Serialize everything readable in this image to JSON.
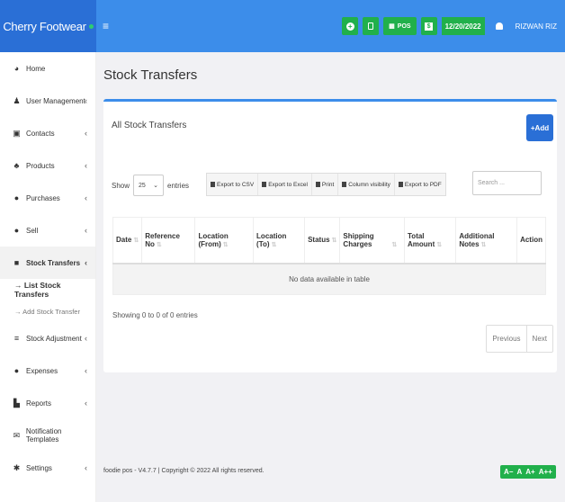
{
  "brand": {
    "name": "Cherry Footwear"
  },
  "topbar": {
    "menu_icon": "≡",
    "pos_label": "POS",
    "date": "12/20/2022",
    "user": "RIZWAN RIZ"
  },
  "sidebar": {
    "items": [
      {
        "label": "Home",
        "icon": "dashboard-icon",
        "chevron": ""
      },
      {
        "label": "User Management",
        "icon": "users-icon",
        "chevron": "‹"
      },
      {
        "label": "Contacts",
        "icon": "address-book-icon",
        "chevron": "‹"
      },
      {
        "label": "Products",
        "icon": "cubes-icon",
        "chevron": "‹"
      },
      {
        "label": "Purchases",
        "icon": "arrow-circle-down-icon",
        "chevron": "‹"
      },
      {
        "label": "Sell",
        "icon": "arrow-circle-up-icon",
        "chevron": "‹"
      },
      {
        "label": "Stock Transfers",
        "icon": "truck-icon",
        "chevron": "‹"
      },
      {
        "label": "Stock Adjustment",
        "icon": "database-icon",
        "chevron": "‹"
      },
      {
        "label": "Expenses",
        "icon": "minus-circle-icon",
        "chevron": "‹"
      },
      {
        "label": "Reports",
        "icon": "chart-icon",
        "chevron": "‹"
      },
      {
        "label": "Notification Templates",
        "icon": "envelope-icon",
        "chevron": ""
      },
      {
        "label": "Settings",
        "icon": "cog-icon",
        "chevron": "‹"
      }
    ],
    "subitems": [
      {
        "label": "→ List Stock Transfers"
      },
      {
        "label": "→ Add Stock Transfer"
      }
    ]
  },
  "main": {
    "page_title": "Stock Transfers",
    "card_title": "All Stock Transfers",
    "add_label": "+Add",
    "show_label": "Show",
    "entries_value": "25",
    "entries_label": "entries",
    "exports": [
      "Export to CSV",
      "Export to Excel",
      "Print",
      "Column visibility",
      "Export to PDF"
    ],
    "search_placeholder": "Search ...",
    "columns": [
      "Date",
      "Reference No",
      "Location (From)",
      "Location (To)",
      "Status",
      "Shipping Charges",
      "Total Amount",
      "Additional Notes",
      "Action"
    ],
    "empty_text": "No data available in table",
    "info_text": "Showing 0 to 0 of 0 entries",
    "prev_label": "Previous",
    "next_label": "Next"
  },
  "footer": {
    "text": "foodie pos - V4.7.7 | Copyright © 2022 All rights reserved.",
    "font_controls": [
      "A−",
      "A",
      "A+",
      "A++"
    ]
  }
}
